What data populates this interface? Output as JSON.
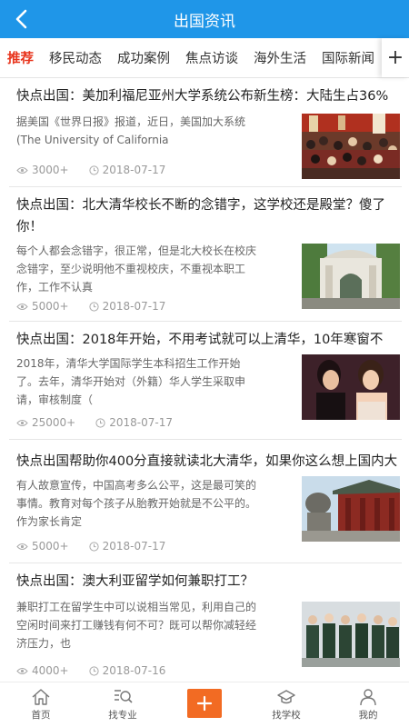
{
  "header": {
    "title": "出国资讯"
  },
  "tabs": [
    {
      "label": "推荐"
    },
    {
      "label": "移民动态"
    },
    {
      "label": "成功案例"
    },
    {
      "label": "焦点访谈"
    },
    {
      "label": "海外生活"
    },
    {
      "label": "国际新闻"
    }
  ],
  "tab_add_label": "+",
  "articles": [
    {
      "title": "快点出国：美加利福尼亚州大学系统公布新生榜：大陆生占36%",
      "summary": "据美国《世界日报》报道，近日，美国加大系统(The University of California",
      "views": "3000+",
      "date": "2018-07-17",
      "thumb_icon": "graduation-ceremony-photo"
    },
    {
      "title": "快点出国：北大清华校长不断的念错字，这学校还是殿堂？傻了你！",
      "summary": "每个人都会念错字，很正常，但是北大校长在校庆念错字，至少说明他不重视校庆，不重视本职工作，工作不认真",
      "views": "5000+",
      "date": "2018-07-17",
      "thumb_icon": "university-gate-photo"
    },
    {
      "title": "快点出国：2018年开始，不用考试就可以上清华，10年寒窗不",
      "summary": "2018年，清华大学国际学生本科招生工作开始了。去年，清华开始对（外籍）华人学生采取申请，审核制度（",
      "views": "25000+",
      "date": "2018-07-17",
      "thumb_icon": "women-laughing-photo"
    },
    {
      "title": "快点出国帮助你400分直接就读北大清华，如果你这么想上国内大",
      "summary": "有人故意宣传，中国高考多么公平，这是最可笑的事情。教育对每个孩子从胎教开始就是不公平的。作为家长肯定",
      "views": "5000+",
      "date": "2018-07-17",
      "thumb_icon": "stone-lion-gate-photo"
    },
    {
      "title": "快点出国：澳大利亚留学如何兼职打工？",
      "summary": "兼职打工在留学生中可以说相当常见，利用自己的空闲时间来打工赚钱有何不可？既可以帮你减轻经济压力，也",
      "views": "4000+",
      "date": "2018-07-16",
      "thumb_icon": "students-group-photo"
    }
  ],
  "bottom_bar": [
    {
      "label": "首页",
      "icon": "home-icon"
    },
    {
      "label": "找专业",
      "icon": "search-major-icon"
    },
    {
      "label": "",
      "icon": "plus-icon"
    },
    {
      "label": "找学校",
      "icon": "school-icon"
    },
    {
      "label": "我的",
      "icon": "user-icon"
    }
  ],
  "colors": {
    "header": "#1f96e8",
    "accent_tab": "#e8341c",
    "plus_button": "#f26b23"
  }
}
